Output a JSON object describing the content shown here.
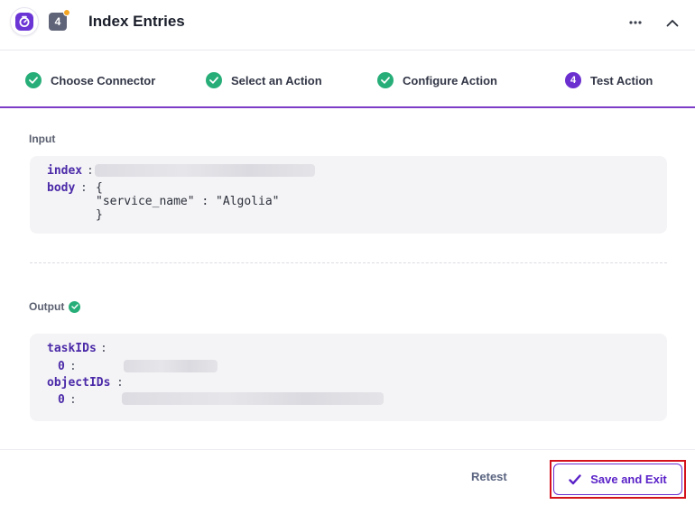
{
  "header": {
    "title": "Index Entries",
    "step_number": "4",
    "logo_icon": "algolia-timer-icon",
    "more_icon": "ellipsis-horizontal-icon",
    "collapse_icon": "chevron-up-icon"
  },
  "steps": [
    {
      "label": "Choose Connector",
      "status": "done"
    },
    {
      "label": "Select an Action",
      "status": "done"
    },
    {
      "label": "Configure Action",
      "status": "done"
    },
    {
      "label": "Test Action",
      "status": "current",
      "number": "4"
    }
  ],
  "input": {
    "label": "Input",
    "index_key": "index",
    "body_key": "body",
    "body_open": "{",
    "body_line": "\"service_name\" : \"Algolia\"",
    "body_close": "}"
  },
  "output": {
    "label": "Output",
    "task_ids_key": "taskIDs",
    "object_ids_key": "objectIDs",
    "index_zero": "0"
  },
  "footer": {
    "retest_label": "Retest",
    "save_label": "Save and Exit"
  },
  "colors": {
    "accent": "#6b2fd0",
    "success": "#27ae78",
    "highlight": "#d4121c"
  }
}
